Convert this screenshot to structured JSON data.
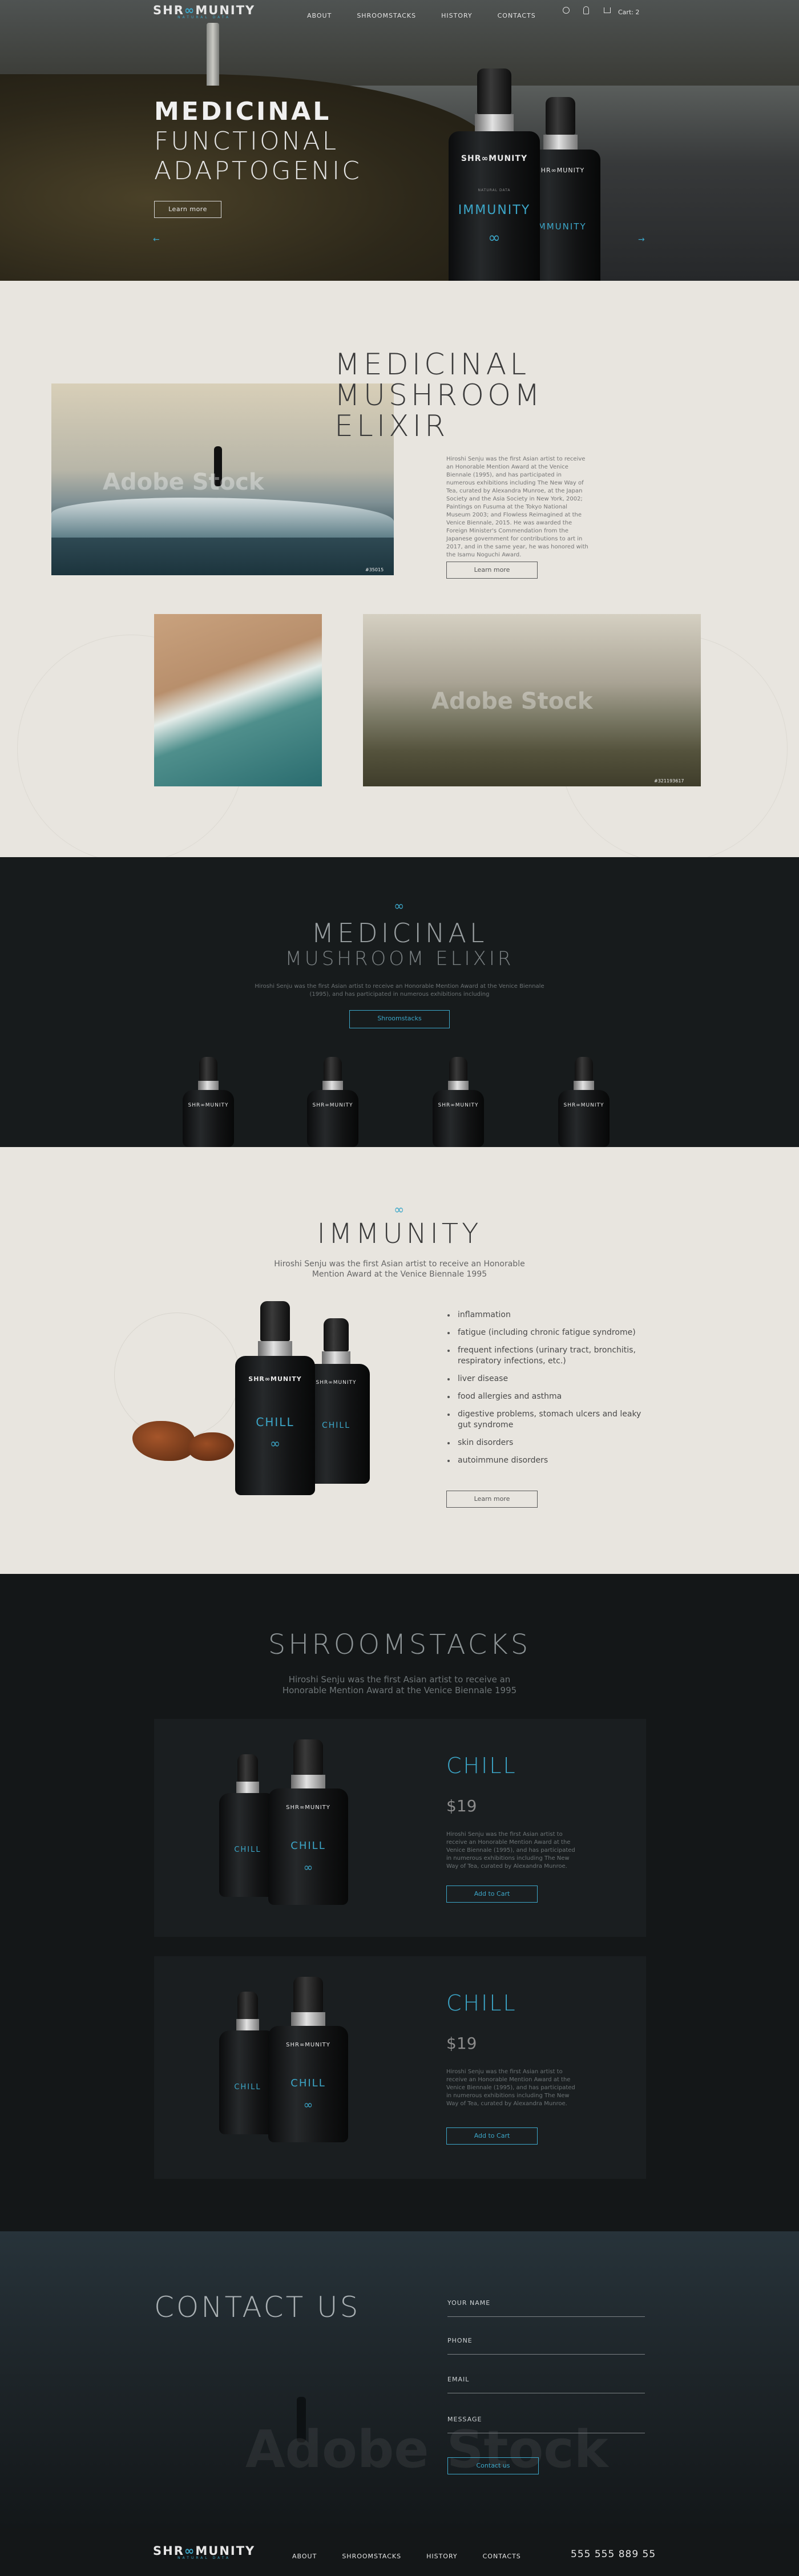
{
  "header": {
    "logo": "SHR",
    "logo_x": "∞",
    "logo_rest": "MUNITY",
    "logo_sub": "NATURAL DATA",
    "nav": [
      "ABOUT",
      "SHROOMSTACKS",
      "HISTORY",
      "CONTACTS"
    ],
    "cart_label": "Cart",
    "cart_count": "2"
  },
  "hero": {
    "line1": "MEDICINAL",
    "line2": "FUNCTIONAL",
    "line3": "ADAPTOGENIC",
    "button": "Learn more",
    "bottle_brand": "SHR∞MUNITY",
    "bottle_name": "IMMUNITY",
    "bottle_sub": "NATURAL DATA",
    "arrow_left": "←",
    "arrow_right": "→"
  },
  "about": {
    "title": [
      "MEDICINAL",
      "MUSHROOM",
      "ELIXIR"
    ],
    "text": "Hiroshi Senju was the first Asian artist to receive an Honorable Mention Award at the Venice Biennale (1995), and has participated in numerous exhibitions including The New Way of Tea, curated by Alexandra Munroe, at the Japan Society and the Asia Society in New York, 2002; Paintings on Fusuma at the Tokyo National Museum 2003; and Flowless Reimagined at the Venice Biennale, 2015. He was awarded the Foreign Minister's Commendation from the Japanese government for contributions to art in 2017, and in the same year, he was honored with the Isamu Noguchi Award.",
    "button": "Learn more",
    "watermark": "Adobe Stock",
    "photo_id1": "#35015",
    "photo_id2": "#321193617"
  },
  "elixir": {
    "title": "MEDICINAL",
    "subtitle": "MUSHROOM ELIXIR",
    "text": "Hiroshi Senju was the first Asian artist to receive an Honorable Mention Award at the Venice Biennale (1995), and has participated in numerous exhibitions including",
    "button": "Shroomstacks",
    "bottle_brand": "SHR∞MUNITY"
  },
  "immunity": {
    "title": "IMMUNITY",
    "text": "Hiroshi Senju was the first Asian artist to receive an Honorable Mention Award at the Venice Biennale 1995",
    "list": [
      "inflammation",
      "fatigue (including chronic fatigue syndrome)",
      "frequent infections (urinary tract, bronchitis, respiratory infections, etc.)",
      "liver disease",
      "food allergies and asthma",
      "digestive problems, stomach ulcers and leaky gut syndrome",
      "skin disorders",
      "autoimmune disorders"
    ],
    "button": "Learn more",
    "bottle_brand": "SHR∞MUNITY",
    "bottle_name": "CHILL"
  },
  "shroomstacks": {
    "title": "SHROOMSTACKS",
    "text": "Hiroshi Senju was the first Asian artist to receive an Honorable Mention Award at the Venice Biennale 1995",
    "products": [
      {
        "name": "CHILL",
        "price": "$19",
        "text": "Hiroshi Senju was the first Asian artist to receive an Honorable Mention Award at the Venice Biennale (1995), and has participated in numerous exhibitions including The New Way of Tea, curated by Alexandra Munroe.",
        "button": "Add to Cart",
        "bottle_name": "CHILL",
        "bottle_brand": "SHR∞MUNITY"
      },
      {
        "name": "CHILL",
        "price": "$19",
        "text": "Hiroshi Senju was the first Asian artist to receive an Honorable Mention Award at the Venice Biennale (1995), and has participated in numerous exhibitions including The New Way of Tea, curated by Alexandra Munroe.",
        "button": "Add to Cart",
        "bottle_name": "CHILL",
        "bottle_brand": "SHR∞MUNITY"
      }
    ]
  },
  "contact": {
    "title": "CONTACT US",
    "fields": [
      "YOUR NAME",
      "PHONE",
      "EMAIL",
      "MESSAGE"
    ],
    "button": "Contact us",
    "watermark": "Adobe Stock"
  },
  "footer": {
    "nav": [
      "ABOUT",
      "SHROOMSTACKS",
      "HISTORY",
      "CONTACTS"
    ],
    "phone": "555 555 889 55"
  },
  "colors": {
    "accent": "#3ca7c9",
    "dark": "#141718",
    "light": "#e8e5df"
  }
}
